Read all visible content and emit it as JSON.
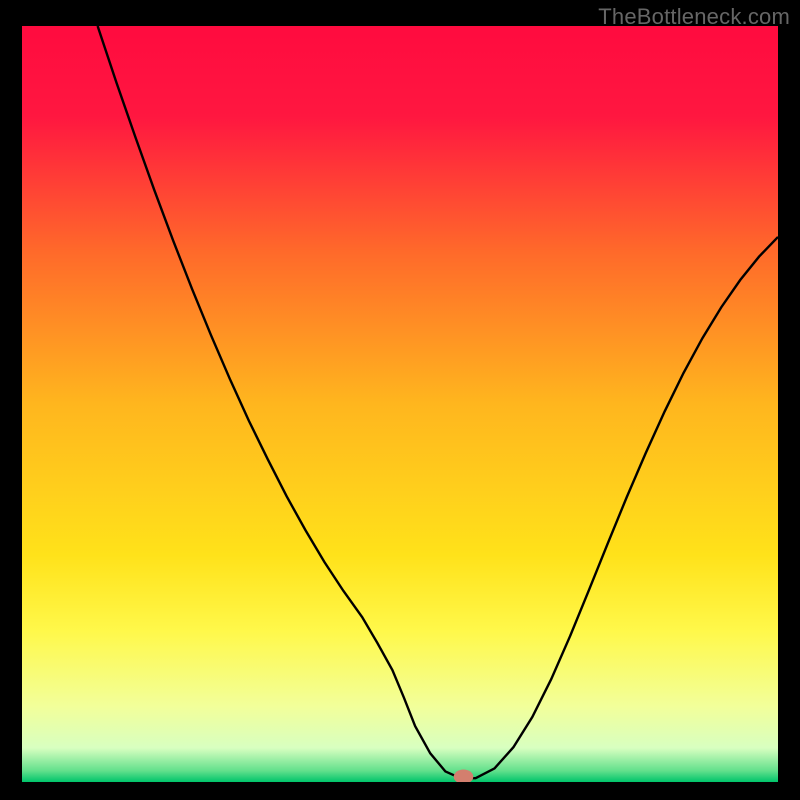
{
  "watermark": "TheBottleneck.com",
  "chart_data": {
    "type": "line",
    "title": "",
    "xlabel": "",
    "ylabel": "",
    "xlim": [
      0,
      100
    ],
    "ylim": [
      0,
      100
    ],
    "background_gradient_stops": [
      {
        "offset": 0,
        "color": "#ff0b3f"
      },
      {
        "offset": 0.12,
        "color": "#ff1740"
      },
      {
        "offset": 0.3,
        "color": "#ff6a2a"
      },
      {
        "offset": 0.5,
        "color": "#ffb61e"
      },
      {
        "offset": 0.7,
        "color": "#ffe21a"
      },
      {
        "offset": 0.8,
        "color": "#fff84a"
      },
      {
        "offset": 0.9,
        "color": "#f2ff9a"
      },
      {
        "offset": 0.955,
        "color": "#d8ffc0"
      },
      {
        "offset": 0.985,
        "color": "#63e08c"
      },
      {
        "offset": 1.0,
        "color": "#00c46a"
      }
    ],
    "series": [
      {
        "name": "curve",
        "color": "#000000",
        "stroke_width": 2.4,
        "x": [
          10.0,
          12.5,
          15.0,
          17.5,
          20.0,
          22.5,
          25.0,
          27.5,
          30.0,
          32.5,
          35.0,
          37.5,
          40.0,
          42.5,
          45.0,
          47.0,
          49.0,
          50.5,
          52.0,
          54.0,
          56.0,
          58.0,
          60.0,
          62.5,
          65.0,
          67.5,
          70.0,
          72.5,
          75.0,
          77.5,
          80.0,
          82.5,
          85.0,
          87.5,
          90.0,
          92.5,
          95.0,
          97.5,
          100.0
        ],
        "y": [
          100.0,
          92.5,
          85.3,
          78.3,
          71.6,
          65.2,
          59.1,
          53.3,
          47.8,
          42.7,
          37.8,
          33.3,
          29.1,
          25.3,
          21.8,
          18.4,
          14.8,
          11.2,
          7.4,
          3.8,
          1.4,
          0.5,
          0.5,
          1.8,
          4.6,
          8.6,
          13.6,
          19.3,
          25.4,
          31.6,
          37.7,
          43.5,
          49.0,
          54.1,
          58.7,
          62.8,
          66.4,
          69.5,
          72.1
        ]
      }
    ],
    "marker": {
      "x": 58.4,
      "y": 0.7,
      "rx": 1.3,
      "ry": 0.95,
      "color": "#d37f6e"
    }
  }
}
